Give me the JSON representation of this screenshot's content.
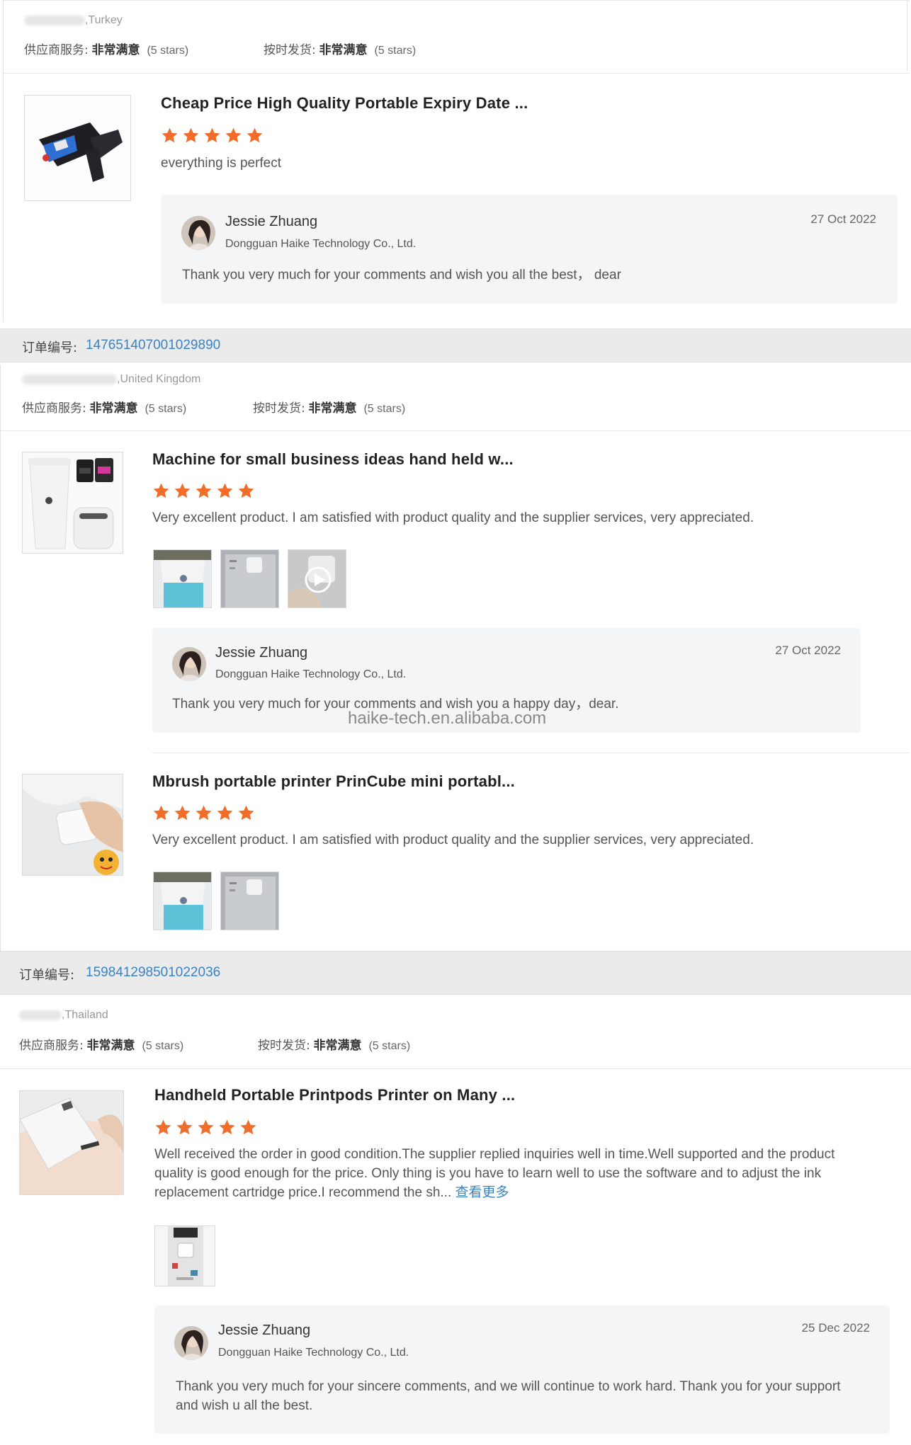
{
  "colors": {
    "accent_blue": "#3b82c4",
    "star_orange": "#f26c2a",
    "order_bar_bg": "#ebebeb",
    "reply_bg": "#f4f5f7"
  },
  "rating_label": {
    "supplier_service": "供应商服务:",
    "on_time": "按时发货:",
    "very_satisfied": "非常满意",
    "stars": "(5 stars)"
  },
  "order_label": "订单编号:",
  "blocks": [
    {
      "location": ",Turkey",
      "supplier_stars": 5,
      "ontime_stars": 5,
      "items": [
        {
          "thumb_icon": "handheld-printer-image",
          "title": "Cheap Price High Quality Portable Expiry Date ...",
          "rating": 5,
          "review": "everything is perfect",
          "reply": {
            "name": "Jessie Zhuang",
            "company": "Dongguan Haike Technology Co., Ltd.",
            "date": "27 Oct 2022",
            "text": "Thank you very much for your comments and wish you all the best， dear"
          }
        }
      ]
    },
    {
      "order_number": "147651407001029890",
      "location": ",United Kingdom",
      "supplier_stars": 5,
      "ontime_stars": 5,
      "items": [
        {
          "thumb_icon": "cup-and-mini-printer-image",
          "title": "Machine for small business ideas hand held w...",
          "rating": 5,
          "review": "Very excellent product. I am satisfied with product quality and the supplier services, very appreciated.",
          "photos": [
            "printed-cup-photo",
            "mini-printer-photo",
            "video-thumbnail"
          ],
          "reply": {
            "name": "Jessie Zhuang",
            "company": "Dongguan Haike Technology Co., Ltd.",
            "date": "27 Oct 2022",
            "text": "Thank you very much for your comments and wish you a happy day，dear."
          }
        },
        {
          "thumb_icon": "mini-printer-on-fabric-image",
          "title": "Mbrush portable printer PrinCube mini portabl...",
          "rating": 5,
          "review": "Very excellent product. I am satisfied with product quality and the supplier services, very appreciated.",
          "photos": [
            "printed-cup-photo",
            "mini-printer-photo"
          ]
        }
      ]
    },
    {
      "order_number": "159841298501022036",
      "location": ",Thailand",
      "supplier_stars": 5,
      "ontime_stars": 5,
      "items": [
        {
          "thumb_icon": "printing-on-hand-image",
          "title": "Handheld Portable Printpods Printer on Many ...",
          "rating": 5,
          "review": "Well received the order in good condition.The supplier replied inquiries well in time.Well supported and the product quality is good enough for the price. Only thing is you have to learn well to use the software and to adjust the ink replacement cartridge price.I recommend the sh...",
          "see_more": "查看更多",
          "photos": [
            "printer-box-photo"
          ],
          "reply": {
            "name": "Jessie Zhuang",
            "company": "Dongguan Haike Technology Co., Ltd.",
            "date": "25 Dec 2022",
            "text": "Thank you very much for your sincere comments, and we will continue to work hard. Thank you for your support and wish u all the best."
          }
        }
      ]
    }
  ],
  "watermark": "haike-tech.en.alibaba.com"
}
